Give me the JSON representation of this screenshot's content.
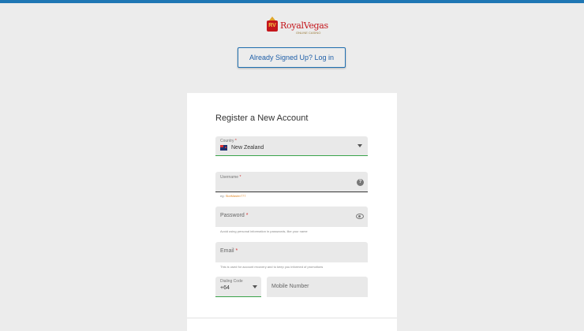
{
  "brand": {
    "badge": "RV",
    "name": "RoyalVegas",
    "tagline": "ONLINE CASINO"
  },
  "login_button": "Already Signed Up? Log in",
  "form": {
    "title": "Register a New Account",
    "country": {
      "label": "Country",
      "value": "New Zealand",
      "flag": "new-zealand-flag"
    },
    "username": {
      "label": "Username",
      "hint_prefix": "eg:",
      "hint_example": "SlotMaster777"
    },
    "password": {
      "label": "Password",
      "hint": "Avoid using personal information in passwords, like your name"
    },
    "email": {
      "label": "Email",
      "hint": "This is used for account recovery and to keep you informed of promotions"
    },
    "dialing_code": {
      "label": "Dialing Code",
      "value": "+64"
    },
    "mobile": {
      "placeholder": "Mobile Number"
    },
    "required_mark": "*"
  },
  "colors": {
    "top_bar": "#1f77b4",
    "brand_red": "#c4161c",
    "link_blue": "#1f5fa8",
    "focus_green": "#3aa34a"
  }
}
